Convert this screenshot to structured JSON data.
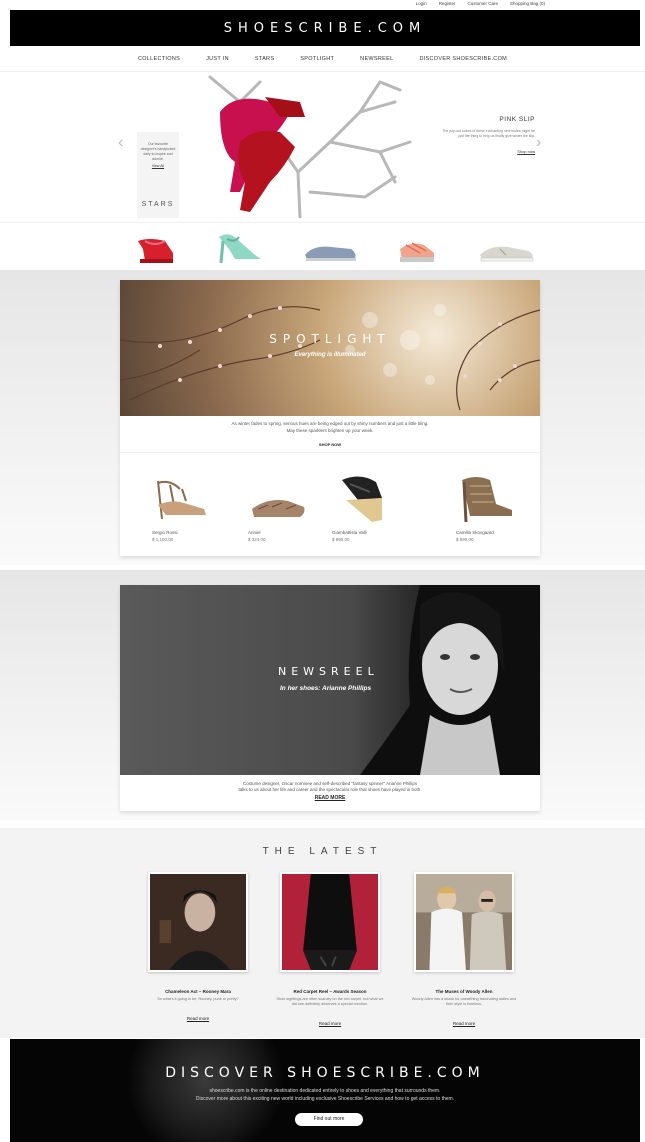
{
  "topbar": {
    "login": "Login",
    "register": "Register",
    "customer_care": "Customer Care",
    "shopping_bag": "Shopping Bag (0)"
  },
  "header": {
    "logo": "SHOESCRIBE.COM"
  },
  "nav": {
    "items": [
      "COLLECTIONS",
      "JUST IN",
      "STARS",
      "SPOTLIGHT",
      "NEWSREEL",
      "DISCOVER SHOESCRIBE.COM"
    ]
  },
  "hero": {
    "stars_blurb": "Our favourite designer's handpicked daily to inspire and admire.",
    "view_all": "View All",
    "stars_label": "STARS",
    "pink_title": "PINK SLIP",
    "pink_desc": "The pop-out colors of these enchanting new mules might be just the thing to help us finally give winter the slip.",
    "shop_now": "Shop now"
  },
  "colors": {
    "black": "#000000",
    "band_grey": "#e6e6e6",
    "accent_pink": "#c8104f",
    "accent_red": "#b3121e",
    "mint": "#8fd8c4"
  },
  "spotlight": {
    "title": "SPOTLIGHT",
    "subtitle": "Everything is illuminated",
    "text_line1": "As winter fades to spring, serious hues are being edged out by shiny numbers and just a little bling.",
    "text_line2": "May these sparklers brighten up your week.",
    "shop_now": "SHOP NOW",
    "products": [
      {
        "name": "Sergio Rossi",
        "price": "$ 1,150.00"
      },
      {
        "name": "Anniel",
        "price": "$ 324.00"
      },
      {
        "name": "Giambattista Valli",
        "price": "$ 890.00"
      },
      {
        "name": "Camilla Skovgaard",
        "price": "$ 590.00"
      }
    ]
  },
  "newsreel": {
    "title": "NEWSREEL",
    "subtitle": "In her shoes: Arianne Phillips",
    "text_line1": "Costume designer, Oscar nominee and self-described \"fantasy spinner\" Arianne Phillips",
    "text_line2": "talks to us about her life and career and the spectacular role that shoes have played in both.",
    "read_more": "READ MORE"
  },
  "latest": {
    "heading": "THE LATEST",
    "items": [
      {
        "title": "Chameleon Act – Rooney Mara",
        "desc": "So what's it going to be, Rooney, punk or pretty?",
        "read_more": "Read more"
      },
      {
        "title": "Red Carpet Reel – Awards Season",
        "desc": "Shoe sightings are often scarcity on the red carpet, but what we did see definitely deserves a special mention.",
        "read_more": "Read more"
      },
      {
        "title": "The Muses of Woody Allen",
        "desc": "Woody Allen has a knack for unearthing fascinating ladies and their style is timeless.",
        "read_more": "Read more"
      }
    ]
  },
  "discover": {
    "title": "DISCOVER SHOESCRIBE.COM",
    "text_line1": "shoescribe.com is the online destination dedicated entirely to shoes and everything that surrounds them.",
    "text_line2": "Discover more about this exciting new world including exclusive Shoescribe Services and how to get access to them.",
    "button": "Find out more"
  }
}
